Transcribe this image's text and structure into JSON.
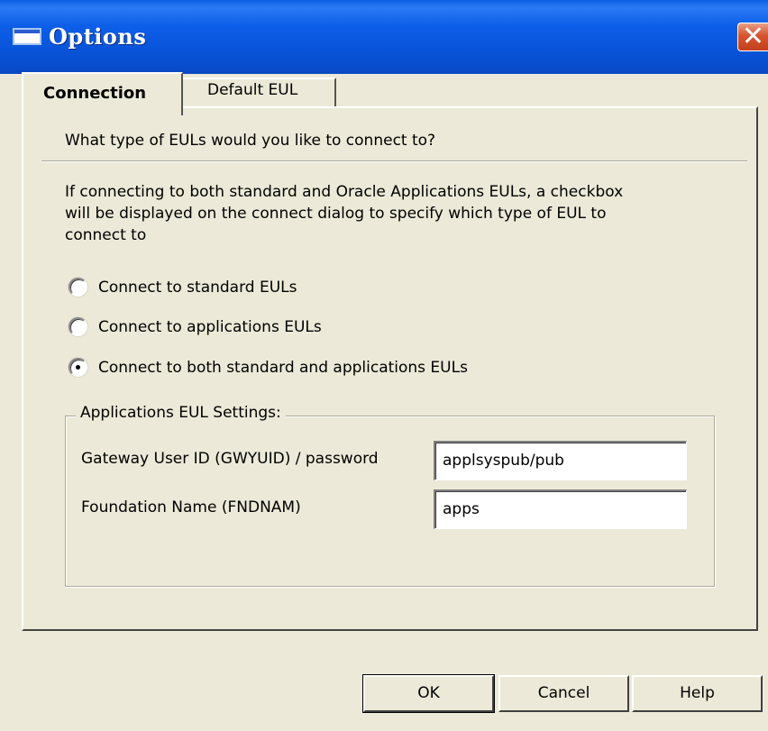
{
  "window": {
    "title": "Options",
    "close_glyph": "✕"
  },
  "tabs": [
    {
      "label": "Connection",
      "active": true
    },
    {
      "label": "Default EUL",
      "active": false
    }
  ],
  "connection": {
    "question": "What type of EULs would you like to connect to?",
    "description_lines": [
      "If connecting to both standard and Oracle Applications EULs, a checkbox",
      "will be displayed on the connect dialog to specify which type of EUL to",
      "connect to"
    ],
    "radio_options": [
      {
        "label": "Connect to standard EULs",
        "checked": false
      },
      {
        "label": "Connect to applications EULs",
        "checked": false
      },
      {
        "label": "Connect to both standard and applications EULs",
        "checked": true
      }
    ],
    "group": {
      "label": "Applications EUL Settings:",
      "gateway_label": "Gateway User ID (GWYUID) / password",
      "gateway_value": "applsyspub/pub",
      "foundation_label": "Foundation Name (FNDNAM)",
      "foundation_value": "apps"
    }
  },
  "buttons": {
    "ok": "OK",
    "cancel": "Cancel",
    "help": "Help"
  }
}
